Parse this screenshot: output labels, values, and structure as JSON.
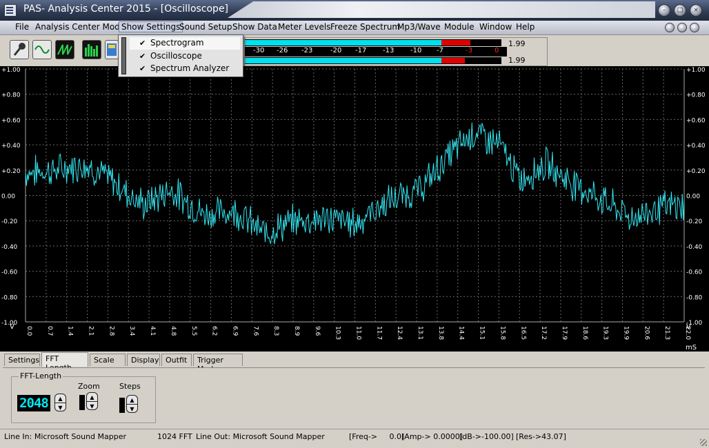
{
  "window": {
    "title": "PAS- Analysis Center 2015 - [Oscilloscope]",
    "controls": [
      "minimize",
      "maximize",
      "close"
    ]
  },
  "menubar": {
    "items": [
      "File",
      "Analysis Center Mode",
      "Show Settings",
      "Sound Setup",
      "Show Data",
      "Meter Levels",
      "Freeze Spectrum",
      "Mp3/Wave",
      "Module",
      "Window",
      "Help"
    ],
    "active": "Show Settings"
  },
  "dropdown": {
    "items": [
      {
        "label": "Spectrogram",
        "checked": true,
        "highlighted": true
      },
      {
        "label": "Oscilloscope",
        "checked": true,
        "highlighted": false
      },
      {
        "label": "Spectrum Analyzer",
        "checked": true,
        "highlighted": false
      }
    ]
  },
  "toolbar": {
    "buttons": [
      "microphone-icon",
      "sine-wave-icon",
      "sawtooth-wave-icon",
      "spectrum-bars-icon",
      "meter-icon"
    ]
  },
  "meters": {
    "scale": [
      "-30",
      "-26",
      "-23",
      "-20",
      "-17",
      "-13",
      "-10",
      "-7",
      "-3",
      "0"
    ],
    "channels": [
      {
        "value": "1.99",
        "level": 0.92
      },
      {
        "value": "1.99",
        "level": 0.92
      }
    ],
    "colors": {
      "low": "#00e0ee",
      "high": "#e00000"
    }
  },
  "oscilloscope": {
    "y_ticks": [
      "+1.00",
      "+0.80",
      "+0.60",
      "+0.40",
      "+0.20",
      "0.00",
      "-0.20",
      "-0.40",
      "-0.60",
      "-0.80",
      "-1.00"
    ],
    "x_ticks": [
      "0.0",
      "0.7",
      "1.4",
      "2.1",
      "2.8",
      "3.4",
      "4.1",
      "4.8",
      "5.5",
      "6.2",
      "6.9",
      "7.6",
      "8.3",
      "8.9",
      "9.6",
      "10.3",
      "11.0",
      "11.7",
      "12.4",
      "13.1",
      "13.8",
      "14.4",
      "15.1",
      "15.8",
      "16.5",
      "17.2",
      "17.9",
      "18.6",
      "19.3",
      "19.9",
      "20.6",
      "21.3",
      "22.0"
    ],
    "y_unit": "V",
    "x_unit": "mS",
    "trace_color": "#33e5f0",
    "grid_color": "#6a6a6a",
    "background": "#000000"
  },
  "tabs": {
    "items": [
      "Settings",
      "FFT Length",
      "Scale",
      "Display",
      "Outfit",
      "Trigger Mode"
    ],
    "active": "FFT Length"
  },
  "fft_panel": {
    "group_title": "FFT-Length",
    "value": "2048",
    "zoom_label": "Zoom",
    "steps_label": "Steps"
  },
  "statusbar": {
    "line_in": "Line In: Microsoft Sound Mapper",
    "fft": "1024 FFT",
    "line_out": "Line Out: Microsoft Sound Mapper",
    "freq": "[Freq->     0.0]",
    "amp": "[Amp-> 0.0000]",
    "db": "[dB->-100.00]",
    "res": "[Res->43.07]"
  }
}
